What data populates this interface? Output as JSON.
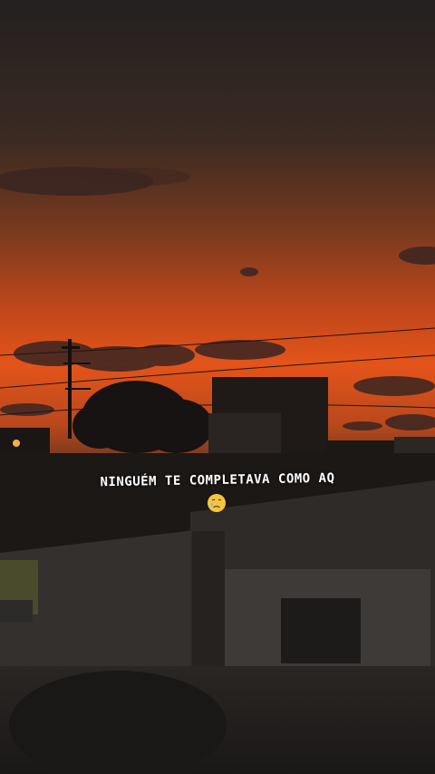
{
  "story": {
    "caption": "NINGUÉM TE COMPLETAVA COMO AQ",
    "emoji_icon": "sad-face-emoji"
  },
  "colors": {
    "sky_top": "#2b2522",
    "sky_mid": "#b8481c",
    "sky_glow": "#e4541a",
    "silhouette": "#161312",
    "wall": "#3a3633"
  }
}
